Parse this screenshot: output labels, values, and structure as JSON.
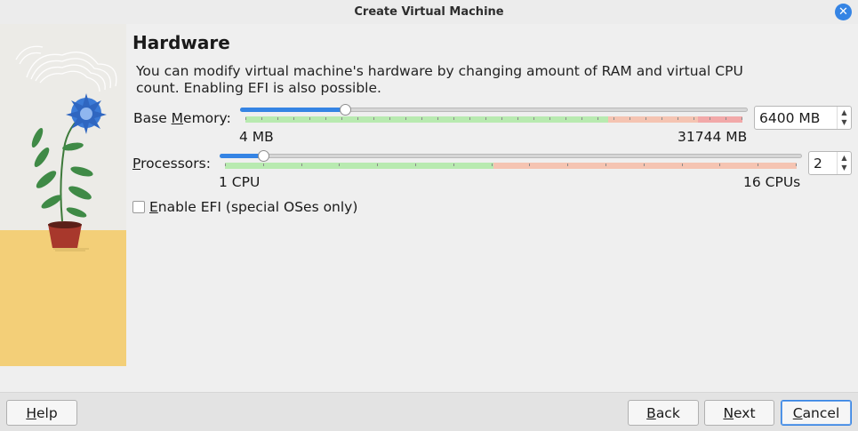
{
  "window": {
    "title": "Create Virtual Machine",
    "close_icon": "close-icon"
  },
  "page": {
    "heading": "Hardware",
    "description": "You can modify virtual machine's hardware by changing amount of RAM and virtual CPU count. Enabling EFI is also possible."
  },
  "memory": {
    "label_pre": "Base ",
    "label_mnemonic": "M",
    "label_post": "emory:",
    "min_label": "4 MB",
    "max_label": "31744 MB",
    "value": "6400 MB",
    "min": 4,
    "max": 31744,
    "current": 6400,
    "zones": {
      "green_end": 0.73,
      "orange_end": 0.91
    }
  },
  "processors": {
    "label_mnemonic": "P",
    "label_post": "rocessors:",
    "min_label": "1 CPU",
    "max_label": "16 CPUs",
    "value": "2",
    "min": 1,
    "max": 16,
    "current": 2,
    "zones": {
      "green_end": 0.47
    }
  },
  "efi": {
    "mnemonic": "E",
    "label_post": "nable EFI (special OSes only)",
    "checked": false
  },
  "buttons": {
    "help_mnemonic": "H",
    "help_post": "elp",
    "back_mnemonic": "B",
    "back_post": "ack",
    "next_mnemonic": "N",
    "next_post": "ext",
    "cancel_mnemonic": "C",
    "cancel_post": "ancel"
  },
  "colors": {
    "accent": "#3584e4",
    "zone_green": "#b8eab0",
    "zone_orange": "#f5c4b2",
    "zone_red": "#f2a9a9"
  }
}
